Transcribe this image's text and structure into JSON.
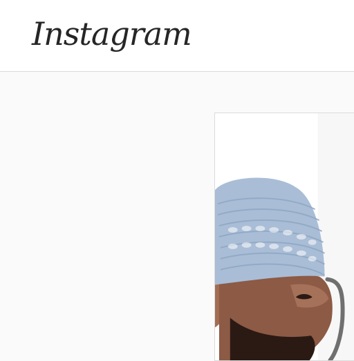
{
  "app": {
    "brand": "Instagram"
  },
  "post": {
    "media_semantic": "photo-of-man-in-knit-kufi-cap"
  },
  "colors": {
    "topbar_bg": "#ffffff",
    "page_bg": "#fafafa",
    "border": "#dbdbdb",
    "text": "#262626",
    "kufi": "#a9bdd6"
  }
}
